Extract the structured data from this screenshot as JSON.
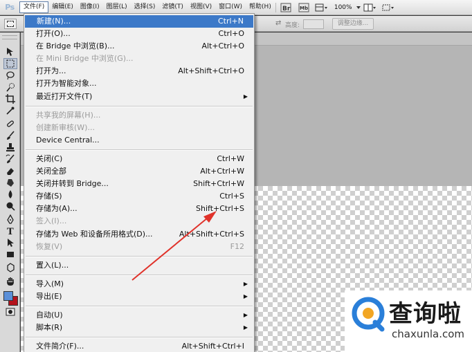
{
  "app": {
    "logo": "Ps"
  },
  "menubar": {
    "items": [
      {
        "label": "文件(F)",
        "active": true
      },
      {
        "label": "编辑(E)"
      },
      {
        "label": "图像(I)"
      },
      {
        "label": "图层(L)"
      },
      {
        "label": "选择(S)"
      },
      {
        "label": "滤镜(T)"
      },
      {
        "label": "视图(V)"
      },
      {
        "label": "窗口(W)"
      },
      {
        "label": "帮助(H)"
      }
    ],
    "zoom": "100%",
    "icons": [
      "bridge-icon",
      "mini-bridge-icon",
      "view-extras-icon",
      "arrange-documents-icon",
      "screen-mode-icon"
    ]
  },
  "options": {
    "height_label": "高度:",
    "refine_edge_label": "调整边缘..."
  },
  "file_menu": {
    "groups": [
      [
        {
          "label": "新建(N)...",
          "shortcut": "Ctrl+N",
          "highlight": true
        },
        {
          "label": "打开(O)...",
          "shortcut": "Ctrl+O"
        },
        {
          "label": "在 Bridge 中浏览(B)...",
          "shortcut": "Alt+Ctrl+O"
        },
        {
          "label": "在 Mini Bridge 中浏览(G)...",
          "shortcut": "",
          "disabled": true
        },
        {
          "label": "打开为...",
          "shortcut": "Alt+Shift+Ctrl+O"
        },
        {
          "label": "打开为智能对象...",
          "shortcut": ""
        },
        {
          "label": "最近打开文件(T)",
          "shortcut": "",
          "submenu": true
        }
      ],
      [
        {
          "label": "共享我的屏幕(H)...",
          "shortcut": "",
          "disabled": true
        },
        {
          "label": "创建新审核(W)...",
          "shortcut": "",
          "disabled": true
        },
        {
          "label": "Device Central...",
          "shortcut": ""
        }
      ],
      [
        {
          "label": "关闭(C)",
          "shortcut": "Ctrl+W"
        },
        {
          "label": "关闭全部",
          "shortcut": "Alt+Ctrl+W"
        },
        {
          "label": "关闭并转到 Bridge...",
          "shortcut": "Shift+Ctrl+W"
        },
        {
          "label": "存储(S)",
          "shortcut": "Ctrl+S"
        },
        {
          "label": "存储为(A)...",
          "shortcut": "Shift+Ctrl+S"
        },
        {
          "label": "签入(I)...",
          "shortcut": "",
          "disabled": true
        },
        {
          "label": "存储为 Web 和设备所用格式(D)...",
          "shortcut": "Alt+Shift+Ctrl+S"
        },
        {
          "label": "恢复(V)",
          "shortcut": "F12",
          "disabled": true
        }
      ],
      [
        {
          "label": "置入(L)...",
          "shortcut": ""
        }
      ],
      [
        {
          "label": "导入(M)",
          "shortcut": "",
          "submenu": true
        },
        {
          "label": "导出(E)",
          "shortcut": "",
          "submenu": true
        }
      ],
      [
        {
          "label": "自动(U)",
          "shortcut": "",
          "submenu": true
        },
        {
          "label": "脚本(R)",
          "shortcut": "",
          "submenu": true
        }
      ],
      [
        {
          "label": "文件简介(F)...",
          "shortcut": "Alt+Shift+Ctrl+I"
        }
      ]
    ]
  },
  "tools": [
    "move-tool-icon",
    "marquee-tool-icon",
    "lasso-tool-icon",
    "quick-selection-tool-icon",
    "crop-tool-icon",
    "eyedropper-tool-icon",
    "healing-brush-tool-icon",
    "brush-tool-icon",
    "clone-stamp-tool-icon",
    "history-brush-tool-icon",
    "eraser-tool-icon",
    "gradient-tool-icon",
    "blur-tool-icon",
    "dodge-tool-icon",
    "pen-tool-icon",
    "type-tool-icon",
    "path-selection-tool-icon",
    "shape-tool-icon",
    "3d-rotate-tool-icon",
    "3d-orbit-tool-icon",
    "hand-tool-icon",
    "zoom-tool-icon"
  ],
  "colors": {
    "foreground": "#5a8fd8",
    "background": "#b3121b",
    "menu_highlight": "#3c79c8",
    "annotation_arrow": "#e0322a"
  },
  "watermark": {
    "cn": "查询啦",
    "en": "chaxunla.com"
  }
}
